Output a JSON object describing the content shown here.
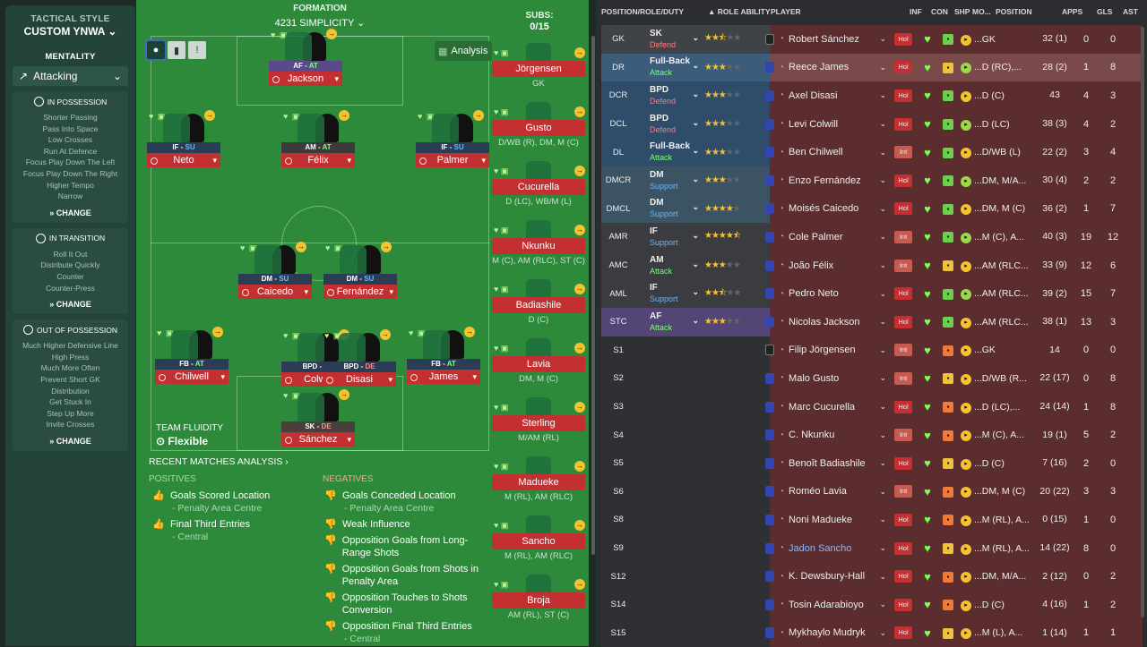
{
  "tactics": {
    "style_title": "TACTICAL STYLE",
    "style_name": "CUSTOM YNWA",
    "mentality_label": "MENTALITY",
    "mentality_value": "Attacking",
    "in_possession": {
      "title": "IN POSSESSION",
      "items": [
        "Shorter Passing",
        "Pass Into Space",
        "Low Crosses",
        "Run At Defence",
        "Focus Play Down The Left",
        "Focus Play Down The Right",
        "Higher Tempo",
        "Narrow"
      ]
    },
    "in_transition": {
      "title": "IN TRANSITION",
      "items": [
        "Roll It Out",
        "Distribute Quickly",
        "Counter",
        "Counter-Press"
      ]
    },
    "out_of_possession": {
      "title": "OUT OF POSSESSION",
      "items": [
        "Much Higher Defensive Line",
        "High Press",
        "Much More Often",
        "Prevent Short GK",
        "Distribution",
        "Get Stuck In",
        "Step Up More",
        "Invite Crosses"
      ]
    },
    "change_label": "CHANGE"
  },
  "formation": {
    "title": "FORMATION",
    "name": "4231 SIMPLICITY",
    "analysis_label": "Analysis",
    "fluidity_label": "TEAM FLUIDITY",
    "fluidity_value": "Flexible",
    "players": [
      {
        "name": "Jackson",
        "role": "AF",
        "duty": "AT"
      },
      {
        "name": "Neto",
        "role": "IF",
        "duty": "SU"
      },
      {
        "name": "Félix",
        "role": "AM",
        "duty": "AT"
      },
      {
        "name": "Palmer",
        "role": "IF",
        "duty": "SU"
      },
      {
        "name": "Caicedo",
        "role": "DM",
        "duty": "SU"
      },
      {
        "name": "Fernández",
        "role": "DM",
        "duty": "SU"
      },
      {
        "name": "Chilwell",
        "role": "FB",
        "duty": "AT"
      },
      {
        "name": "Colwill",
        "role": "BPD",
        "duty": "DE"
      },
      {
        "name": "Disasi",
        "role": "BPD",
        "duty": "DE"
      },
      {
        "name": "James",
        "role": "FB",
        "duty": "AT"
      },
      {
        "name": "Sánchez",
        "role": "SK",
        "duty": "DE"
      }
    ]
  },
  "subs": {
    "title": "SUBS:",
    "count": "0/15",
    "list": [
      {
        "name": "Jörgensen",
        "pos": "GK"
      },
      {
        "name": "Gusto",
        "pos": "D/WB (R), DM, M (C)"
      },
      {
        "name": "Cucurella",
        "pos": "D (LC), WB/M (L)"
      },
      {
        "name": "Nkunku",
        "pos": "M (C), AM (RLC), ST (C)"
      },
      {
        "name": "Badiashile",
        "pos": "D (C)"
      },
      {
        "name": "Lavia",
        "pos": "DM, M (C)"
      },
      {
        "name": "Sterling",
        "pos": "M/AM (RL)"
      },
      {
        "name": "Madueke",
        "pos": "M (RL), AM (RLC)"
      },
      {
        "name": "Sancho",
        "pos": "M (RL), AM (RLC)"
      },
      {
        "name": "Broja",
        "pos": "AM (RL), ST (C)"
      }
    ]
  },
  "analysis": {
    "title": "RECENT MATCHES ANALYSIS",
    "positives_label": "POSITIVES",
    "negatives_label": "NEGATIVES",
    "positives": [
      {
        "text": "Goals Scored Location",
        "sub": "- Penalty Area Centre"
      },
      {
        "text": "Final Third Entries",
        "sub": "- Central"
      }
    ],
    "negatives": [
      {
        "text": "Goals Conceded Location",
        "sub": "- Penalty Area Centre"
      },
      {
        "text": "Weak Influence",
        "sub": ""
      },
      {
        "text": "Opposition Goals from Long-Range Shots",
        "sub": ""
      },
      {
        "text": "Opposition Goals from Shots in Penalty Area",
        "sub": ""
      },
      {
        "text": "Opposition Touches to Shots Conversion",
        "sub": ""
      },
      {
        "text": "Opposition Final Third Entries",
        "sub": "- Central"
      }
    ]
  },
  "squad": {
    "headers": {
      "pos": "POSITION/ROLE/DUTY",
      "ability": "ROLE ABILITY",
      "player": "PLAYER",
      "inf": "INF",
      "con": "CON",
      "shp": "SHP",
      "mo": "MO...",
      "position": "POSITION",
      "apps": "APPS",
      "gls": "GLS",
      "ast": "AST"
    },
    "rows": [
      {
        "slot": "GK",
        "role": "SK",
        "duty": "Defend",
        "stars": 2.5,
        "name": "Robert Sánchez",
        "inf": "Hol",
        "position": "...GK",
        "apps": "32 (1)",
        "gls": "0",
        "ast": "0"
      },
      {
        "slot": "DR",
        "role": "Full-Back",
        "duty": "Attack",
        "stars": 3,
        "name": "Reece James",
        "inf": "Hol",
        "position": "...D (RC),...",
        "apps": "28 (2)",
        "gls": "1",
        "ast": "8"
      },
      {
        "slot": "DCR",
        "role": "BPD",
        "duty": "Defend",
        "stars": 3,
        "name": "Axel Disasi",
        "inf": "Hol",
        "position": "...D (C)",
        "apps": "43",
        "gls": "4",
        "ast": "3"
      },
      {
        "slot": "DCL",
        "role": "BPD",
        "duty": "Defend",
        "stars": 3,
        "name": "Levi Colwill",
        "inf": "Hol",
        "position": "...D (LC)",
        "apps": "38 (3)",
        "gls": "4",
        "ast": "2"
      },
      {
        "slot": "DL",
        "role": "Full-Back",
        "duty": "Attack",
        "stars": 3,
        "name": "Ben Chilwell",
        "inf": "Int",
        "position": "...D/WB (L)",
        "apps": "22 (2)",
        "gls": "3",
        "ast": "4"
      },
      {
        "slot": "DMCR",
        "role": "DM",
        "duty": "Support",
        "stars": 3,
        "name": "Enzo Fernández",
        "inf": "Hol",
        "position": "...DM, M/A...",
        "apps": "30 (4)",
        "gls": "2",
        "ast": "2"
      },
      {
        "slot": "DMCL",
        "role": "DM",
        "duty": "Support",
        "stars": 4,
        "name": "Moisés Caicedo",
        "inf": "Hol",
        "position": "...DM, M (C)",
        "apps": "36 (2)",
        "gls": "1",
        "ast": "7"
      },
      {
        "slot": "AMR",
        "role": "IF",
        "duty": "Support",
        "stars": 4.5,
        "name": "Cole Palmer",
        "inf": "Int",
        "position": "...M (C), A...",
        "apps": "40 (3)",
        "gls": "19",
        "ast": "12"
      },
      {
        "slot": "AMC",
        "role": "AM",
        "duty": "Attack",
        "stars": 3,
        "name": "João Félix",
        "inf": "Int",
        "position": "...AM (RLC...",
        "apps": "33 (9)",
        "gls": "12",
        "ast": "6"
      },
      {
        "slot": "AML",
        "role": "IF",
        "duty": "Support",
        "stars": 2.5,
        "name": "Pedro Neto",
        "inf": "Hol",
        "position": "...AM (RLC...",
        "apps": "39 (2)",
        "gls": "15",
        "ast": "7"
      },
      {
        "slot": "STC",
        "role": "AF",
        "duty": "Attack",
        "stars": 3,
        "name": "Nicolas Jackson",
        "inf": "Hol",
        "position": "...AM (RLC...",
        "apps": "38 (1)",
        "gls": "13",
        "ast": "3"
      },
      {
        "slot": "S1",
        "role": "",
        "duty": "",
        "stars": 0,
        "name": "Filip Jörgensen",
        "inf": "Int",
        "position": "...GK",
        "apps": "14",
        "gls": "0",
        "ast": "0"
      },
      {
        "slot": "S2",
        "role": "",
        "duty": "",
        "stars": 0,
        "name": "Malo Gusto",
        "inf": "Int",
        "position": "...D/WB (R...",
        "apps": "22 (17)",
        "gls": "0",
        "ast": "8"
      },
      {
        "slot": "S3",
        "role": "",
        "duty": "",
        "stars": 0,
        "name": "Marc Cucurella",
        "inf": "Hol",
        "position": "...D (LC),...",
        "apps": "24 (14)",
        "gls": "1",
        "ast": "8"
      },
      {
        "slot": "S4",
        "role": "",
        "duty": "",
        "stars": 0,
        "name": "C. Nkunku",
        "inf": "Int",
        "position": "...M (C), A...",
        "apps": "19 (1)",
        "gls": "5",
        "ast": "2"
      },
      {
        "slot": "S5",
        "role": "",
        "duty": "",
        "stars": 0,
        "name": "Benoît Badiashile",
        "inf": "Hol",
        "position": "...D (C)",
        "apps": "7 (16)",
        "gls": "2",
        "ast": "0"
      },
      {
        "slot": "S6",
        "role": "",
        "duty": "",
        "stars": 0,
        "name": "Roméo Lavia",
        "inf": "Int",
        "position": "...DM, M (C)",
        "apps": "20 (22)",
        "gls": "3",
        "ast": "3"
      },
      {
        "slot": "S8",
        "role": "",
        "duty": "",
        "stars": 0,
        "name": "Noni Madueke",
        "inf": "Hol",
        "position": "...M (RL), A...",
        "apps": "0 (15)",
        "gls": "1",
        "ast": "0"
      },
      {
        "slot": "S9",
        "role": "",
        "duty": "",
        "stars": 0,
        "name": "Jadon Sancho",
        "inf": "Hol",
        "position": "...M (RL), A...",
        "apps": "14 (22)",
        "gls": "8",
        "ast": "0"
      },
      {
        "slot": "S12",
        "role": "",
        "duty": "",
        "stars": 0,
        "name": "K. Dewsbury-Hall",
        "inf": "Hol",
        "position": "...DM, M/A...",
        "apps": "2 (12)",
        "gls": "0",
        "ast": "2"
      },
      {
        "slot": "S14",
        "role": "",
        "duty": "",
        "stars": 0,
        "name": "Tosin Adarabioyo",
        "inf": "Hol",
        "position": "...D (C)",
        "apps": "4 (16)",
        "gls": "1",
        "ast": "2"
      },
      {
        "slot": "S15",
        "role": "",
        "duty": "",
        "stars": 0,
        "name": "Mykhaylo Mudryk",
        "inf": "Hol",
        "position": "...M (L), A...",
        "apps": "1 (14)",
        "gls": "1",
        "ast": "1"
      }
    ]
  },
  "colors": {
    "accent_red": "#c43032",
    "pitch": "#2d8a3a",
    "panel": "#24433a"
  }
}
